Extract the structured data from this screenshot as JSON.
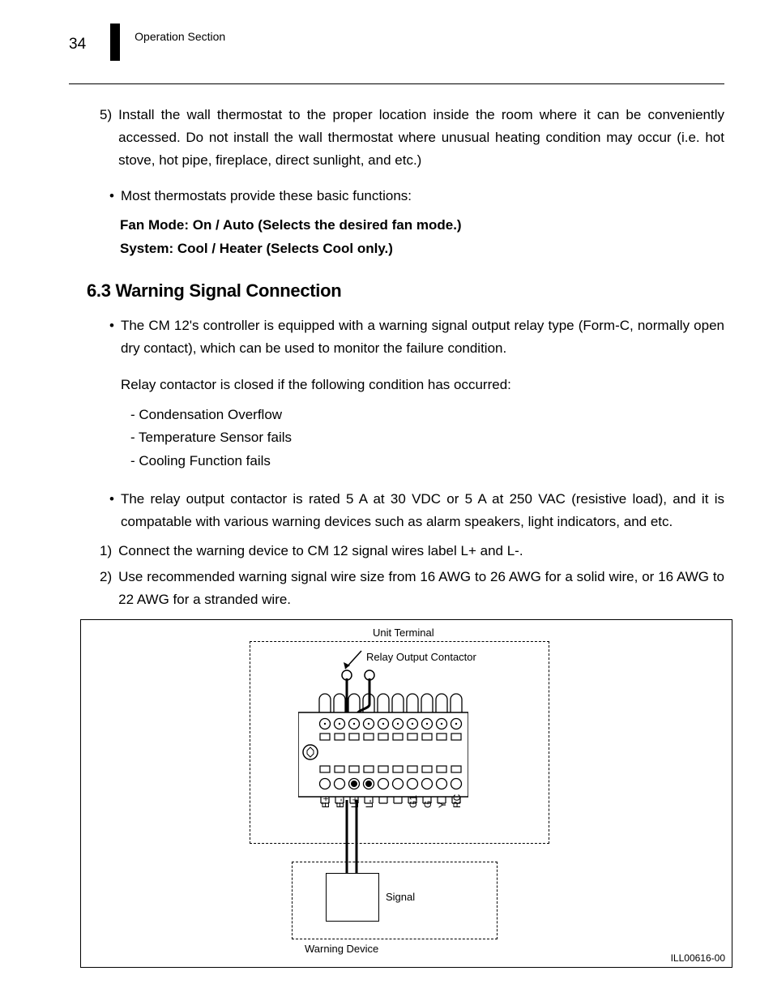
{
  "header": {
    "page_number": "34",
    "section": "Operation Section"
  },
  "body": {
    "item5_num": "5)",
    "item5_text": "Install the wall thermostat to the proper location inside the room where it can be conveniently accessed. Do not install the wall thermostat where unusual heating condition may occur (i.e. hot stove, hot pipe, fireplace, direct sunlight, and etc.)",
    "bullet1_dot": "•",
    "bullet1_text": "Most thermostats provide these basic functions:",
    "bold_line1": "Fan Mode: On / Auto (Selects the desired fan mode.)",
    "bold_line2": "System: Cool / Heater (Selects Cool only.)",
    "heading_63": "6.3  Warning Signal Connection",
    "bullet2_dot": "•",
    "bullet2_text": "The CM 12's controller is equipped with a warning signal output relay type (Form-C, normally open dry contact), which can be used to monitor the failure condition.",
    "para_relay": "Relay contactor is closed if the following condition has occurred:",
    "dash1": "Condensation Overflow",
    "dash2": "Temperature Sensor fails",
    "dash3": "Cooling Function fails",
    "bullet3_dot": "•",
    "bullet3_text": "The relay output contactor is rated 5 A at 30 VDC or 5 A at 250 VAC (resistive load), and it is compatable with various warning devices such as alarm speakers, light indicators, and etc.",
    "num1_num": "1)",
    "num1_text": "Connect the warning device to CM 12 signal wires label L+ and L-.",
    "num2_num": "2)",
    "num2_text": "Use recommended warning signal wire size from 16 AWG to 26 AWG for a solid wire, or 16 AWG to 22 AWG for a stranded wire."
  },
  "chart_data": {
    "type": "diagram",
    "title": "Unit Terminal",
    "labels": {
      "unit_terminal": "Unit Terminal",
      "relay_output": "Relay Output Contactor",
      "signal": "Signal",
      "warning_device": "Warning Device"
    },
    "terminals_upper_count": 10,
    "terminals_lower_count": 10,
    "terminal_names": [
      "E+",
      "E-",
      "L+",
      "L-",
      "G1",
      "G",
      "Y",
      "RC"
    ],
    "illustration_code": "ILL00616-00"
  }
}
